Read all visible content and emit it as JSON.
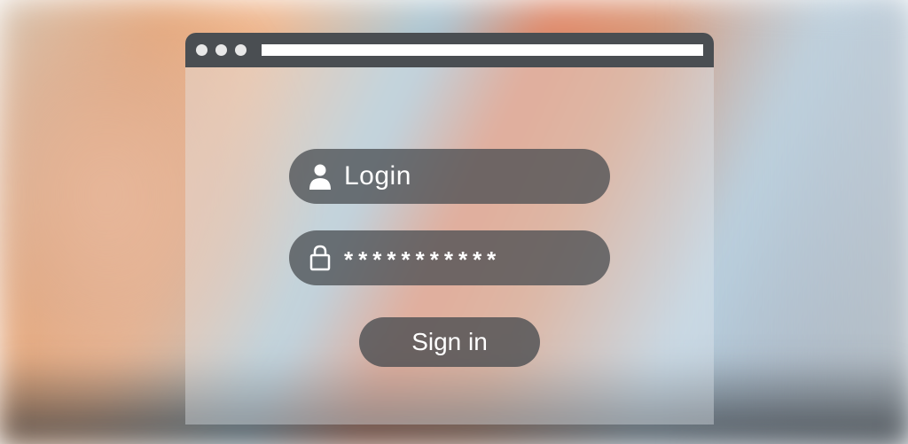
{
  "form": {
    "login_label": "Login",
    "password_masked": "***********",
    "signin_label": "Sign in"
  },
  "icons": {
    "user": "user-icon",
    "lock": "lock-icon"
  },
  "colors": {
    "chrome_dark": "#4a4e52",
    "pill_bg": "rgba(72,76,80,0.75)",
    "text_light": "#ffffff"
  }
}
